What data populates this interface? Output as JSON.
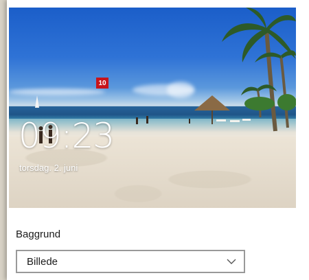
{
  "lock_screen_preview": {
    "time": "09:23",
    "date": "torsdag. 2. juni",
    "badge": "10"
  },
  "background_setting": {
    "label": "Baggrund",
    "selected_value": "Billede"
  },
  "icons": {
    "dropdown": "chevron-down-icon"
  }
}
